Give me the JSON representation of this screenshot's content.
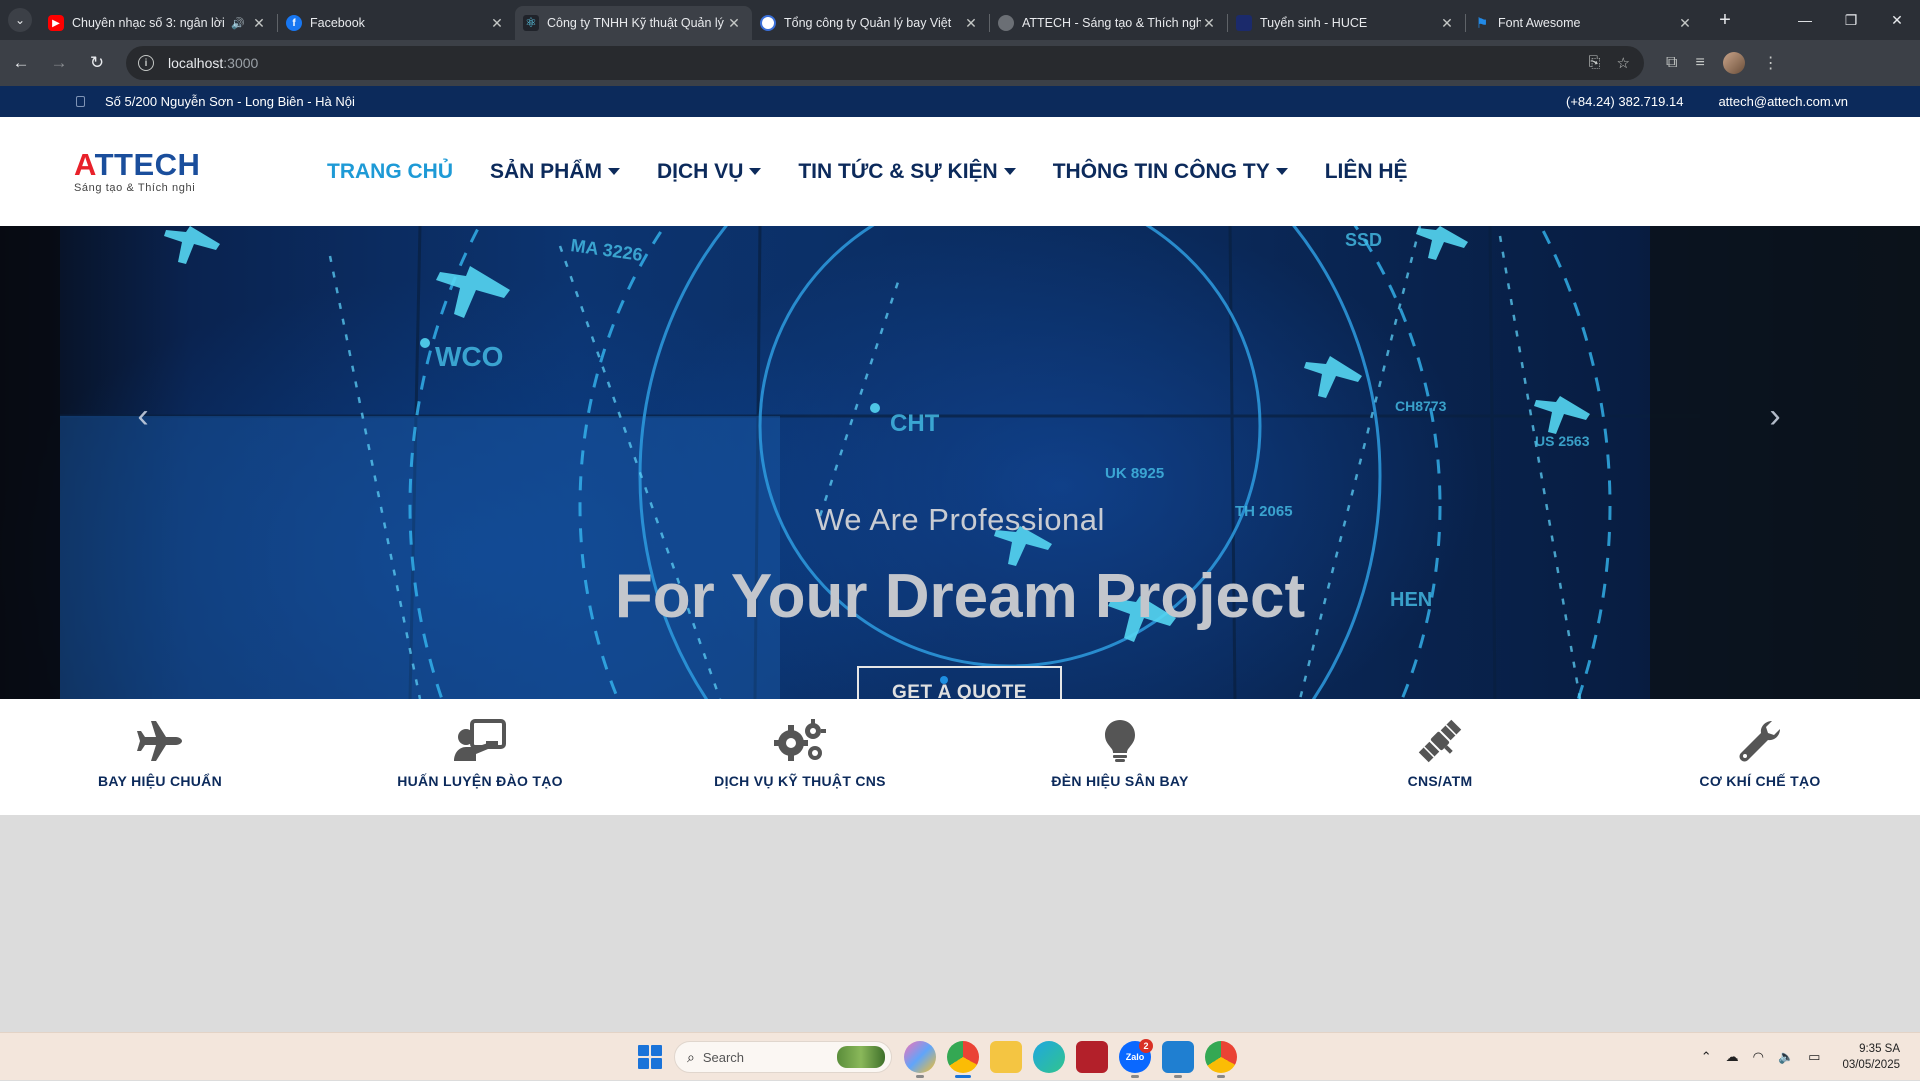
{
  "browser": {
    "tabs": [
      {
        "title": "Chuyên nhạc số 3: ngân lời",
        "favicon": "youtube-icon",
        "color": "#ff0000",
        "audio": true,
        "active": false
      },
      {
        "title": "Facebook",
        "favicon": "facebook-icon",
        "color": "#1877f2",
        "audio": false,
        "active": false
      },
      {
        "title": "Công ty TNHH Kỹ thuật Quản lý",
        "favicon": "react-icon",
        "color": "#61dafb",
        "audio": false,
        "active": true
      },
      {
        "title": "Tổng công ty Quản lý bay Việt",
        "favicon": "vatm-icon",
        "color": "#3a6fd8",
        "audio": false,
        "active": false
      },
      {
        "title": "ATTECH - Sáng tạo & Thích nghi",
        "favicon": "globe-icon",
        "color": "#8a8d91",
        "audio": false,
        "active": false
      },
      {
        "title": "Tuyển sinh - HUCE",
        "favicon": "huce-icon",
        "color": "#1b2a6b",
        "audio": false,
        "active": false
      },
      {
        "title": "Font Awesome",
        "favicon": "flag-icon",
        "color": "#228ae6",
        "audio": false,
        "active": false
      }
    ],
    "url": {
      "host": "localhost",
      "port": ":3000"
    }
  },
  "site": {
    "topbar": {
      "address": "Số 5/200 Nguyễn Sơn - Long Biên - Hà Nội",
      "phone": "(+84.24) 382.719.14",
      "email": "attech@attech.com.vn"
    },
    "logo": {
      "brand_first": "A",
      "brand_rest": "TTECH",
      "slogan": "Sáng tạo & Thích nghi"
    },
    "nav": [
      {
        "label": "TRANG CHỦ",
        "dropdown": false,
        "active": true
      },
      {
        "label": "SẢN PHẨM",
        "dropdown": true,
        "active": false
      },
      {
        "label": "DỊCH VỤ",
        "dropdown": true,
        "active": false
      },
      {
        "label": "TIN TỨC & SỰ KIỆN",
        "dropdown": true,
        "active": false
      },
      {
        "label": "THÔNG TIN CÔNG TY",
        "dropdown": true,
        "active": false
      },
      {
        "label": "LIÊN HỆ",
        "dropdown": false,
        "active": false
      }
    ],
    "hero": {
      "subtitle": "We Are Professional",
      "title": "For Your Dream Project",
      "cta": "GET A QUOTE",
      "radar_labels": [
        "MA 3226",
        "WCO",
        "CHT",
        "UK 8925",
        "TH 2065",
        "SSD",
        "CH8773",
        "US 2563",
        "HEN"
      ]
    },
    "services": [
      {
        "label": "BAY HIỆU CHUẨN",
        "icon": "plane-icon"
      },
      {
        "label": "HUẤN LUYỆN ĐÀO TẠO",
        "icon": "chalkboard-teacher-icon"
      },
      {
        "label": "DỊCH VỤ KỸ THUẬT CNS",
        "icon": "gears-icon"
      },
      {
        "label": "ĐÈN HIỆU SÂN BAY",
        "icon": "lightbulb-icon"
      },
      {
        "label": "CNS/ATM",
        "icon": "satellite-icon"
      },
      {
        "label": "CƠ KHÍ CHẾ TẠO",
        "icon": "wrench-icon"
      }
    ]
  },
  "taskbar": {
    "search_placeholder": "Search",
    "zalo_badge": "2",
    "time": "9:35 SA",
    "date": "03/05/2025"
  }
}
